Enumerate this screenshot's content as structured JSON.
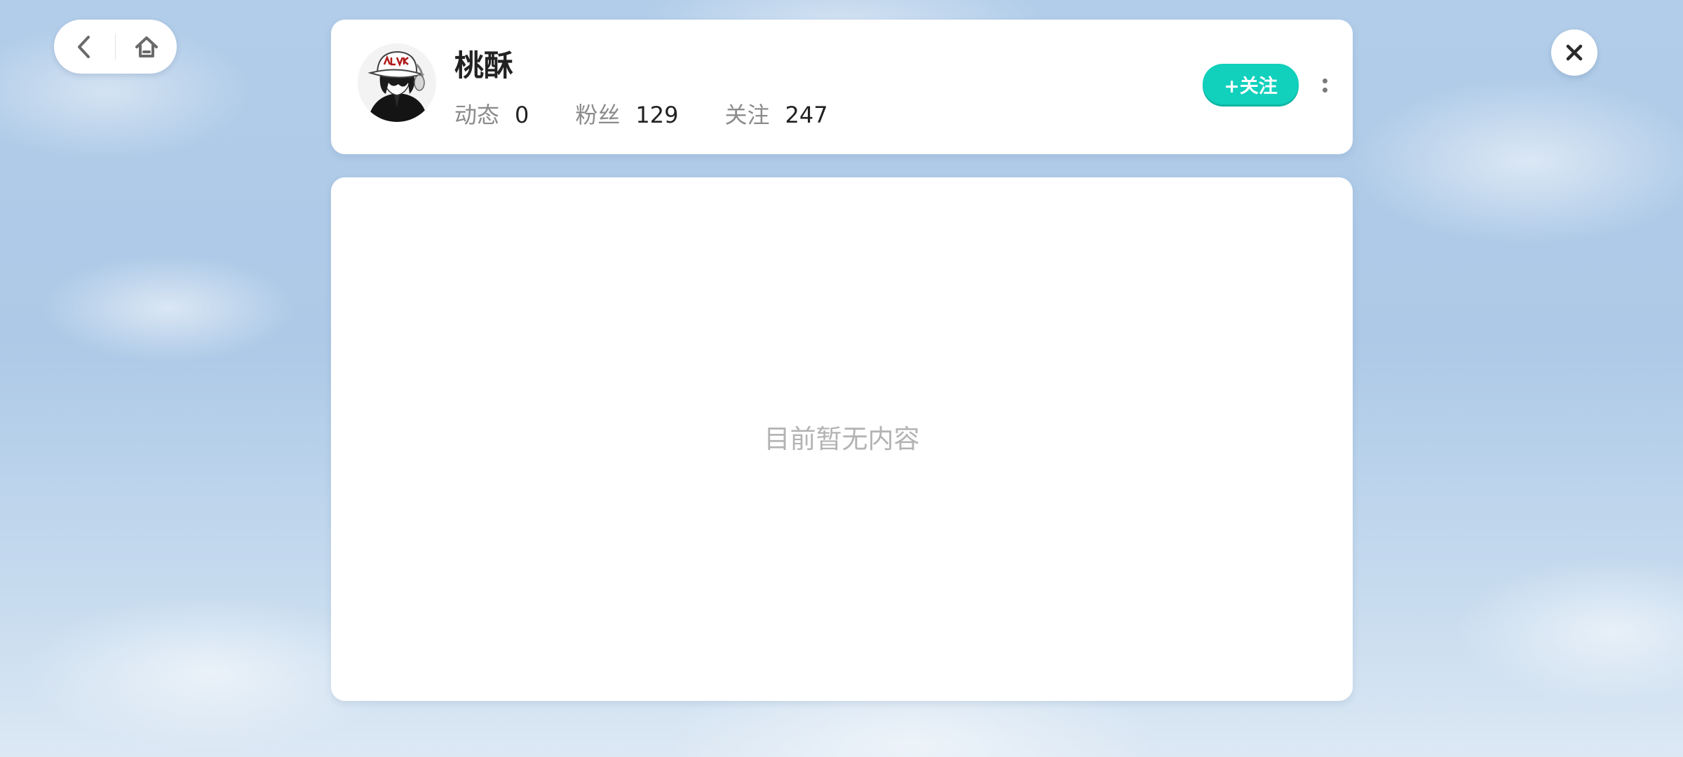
{
  "nav": {
    "back_icon": "chevron-left-icon",
    "home_icon": "home-icon"
  },
  "close_icon": "close-icon",
  "profile": {
    "username": "桃酥",
    "avatar_icon": "avatar-illustration",
    "stats": [
      {
        "label": "动态",
        "value": "0"
      },
      {
        "label": "粉丝",
        "value": "129"
      },
      {
        "label": "关注",
        "value": "247"
      }
    ],
    "follow_label": "+关注",
    "more_icon": "more-vertical-icon",
    "accent_color": "#11d0bc"
  },
  "content": {
    "empty_message": "目前暂无内容"
  }
}
